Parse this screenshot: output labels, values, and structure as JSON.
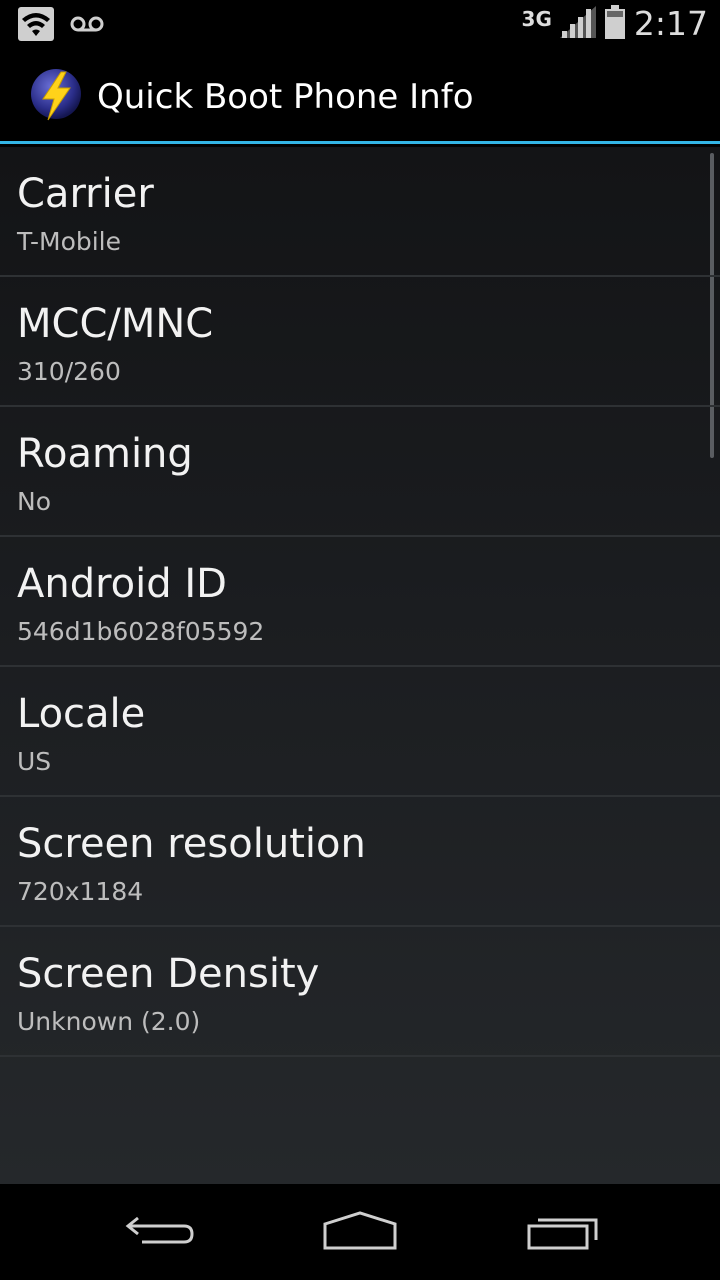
{
  "status_bar": {
    "icons": [
      "wifi-icon",
      "voicemail-icon",
      "signal-icon",
      "battery-icon"
    ],
    "network": "3G",
    "time": "2:17"
  },
  "action_bar": {
    "title": "Quick Boot Phone Info",
    "icon": "lightning-bolt-icon",
    "accent_color": "#33b5e5"
  },
  "info": [
    {
      "label": "Carrier",
      "value": "T-Mobile"
    },
    {
      "label": "MCC/MNC",
      "value": "310/260"
    },
    {
      "label": "Roaming",
      "value": "No"
    },
    {
      "label": "Android ID",
      "value": "546d1b6028f05592"
    },
    {
      "label": "Locale",
      "value": "US"
    },
    {
      "label": "Screen resolution",
      "value": "720x1184"
    },
    {
      "label": "Screen Density",
      "value": "Unknown (2.0)"
    }
  ],
  "nav_bar": {
    "buttons": [
      "back-icon",
      "home-icon",
      "recents-icon"
    ]
  }
}
